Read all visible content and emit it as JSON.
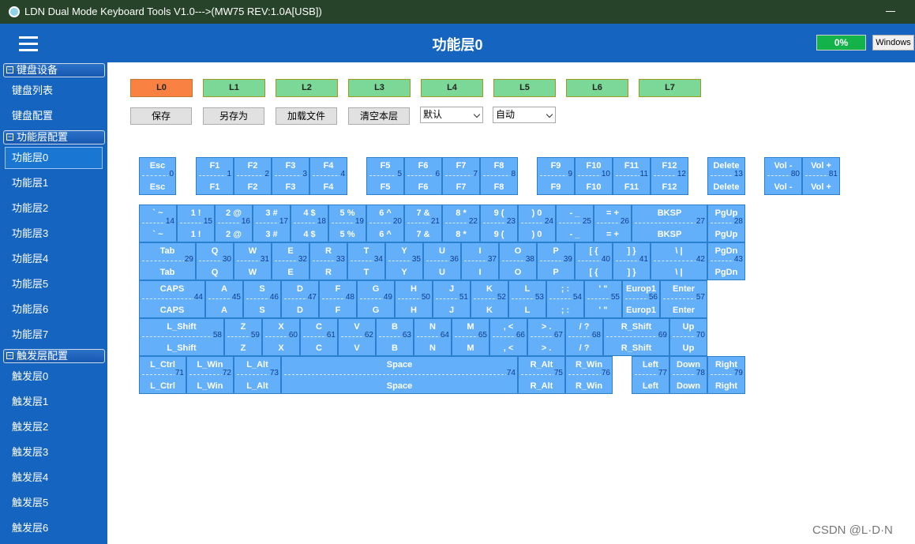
{
  "window": {
    "title": "LDN Dual Mode Keyboard Tools V1.0--->(MW75 REV:1.0A[USB])"
  },
  "header": {
    "page_title": "功能层0",
    "progress": "0%",
    "os_label": "Windows"
  },
  "sidebar": {
    "sections": [
      {
        "title": "键盘设备",
        "toggle": "−"
      },
      {
        "title": "功能层配置",
        "toggle": "−"
      },
      {
        "title": "触发层配置",
        "toggle": "−"
      }
    ],
    "device_items": [
      "键盘列表",
      "键盘配置"
    ],
    "fn_layer_items": [
      "功能层0",
      "功能层1",
      "功能层2",
      "功能层3",
      "功能层4",
      "功能层5",
      "功能层6",
      "功能层7"
    ],
    "trigger_layer_items": [
      "触发层0",
      "触发层1",
      "触发层2",
      "触发层3",
      "触发层4",
      "触发层5",
      "触发层6"
    ]
  },
  "layers": [
    "L0",
    "L1",
    "L2",
    "L3",
    "L4",
    "L5",
    "L6",
    "L7"
  ],
  "active_layer": "L0",
  "toolbar": {
    "save": "保存",
    "save_as": "另存为",
    "load_file": "加载文件",
    "clear_layer": "清空本层",
    "select_default": "默认",
    "select_auto": "自动"
  },
  "keys": [
    {
      "t": "Esc",
      "b": "Esc",
      "n": "0"
    },
    {
      "t": "F1",
      "b": "F1",
      "n": "1"
    },
    {
      "t": "F2",
      "b": "F2",
      "n": "2"
    },
    {
      "t": "F3",
      "b": "F3",
      "n": "3"
    },
    {
      "t": "F4",
      "b": "F4",
      "n": "4"
    },
    {
      "t": "F5",
      "b": "F5",
      "n": "5"
    },
    {
      "t": "F6",
      "b": "F6",
      "n": "6"
    },
    {
      "t": "F7",
      "b": "F7",
      "n": "7"
    },
    {
      "t": "F8",
      "b": "F8",
      "n": "8"
    },
    {
      "t": "F9",
      "b": "F9",
      "n": "9"
    },
    {
      "t": "F10",
      "b": "F10",
      "n": "10"
    },
    {
      "t": "F11",
      "b": "F11",
      "n": "11"
    },
    {
      "t": "F12",
      "b": "F12",
      "n": "12"
    },
    {
      "t": "Delete",
      "b": "Delete",
      "n": "13"
    },
    {
      "t": "Vol -",
      "b": "Vol -",
      "n": "80"
    },
    {
      "t": "Vol +",
      "b": "Vol +",
      "n": "81"
    },
    {
      "t": "` ~",
      "b": "` ~",
      "n": "14"
    },
    {
      "t": "1 !",
      "b": "1 !",
      "n": "15"
    },
    {
      "t": "2 @",
      "b": "2 @",
      "n": "16"
    },
    {
      "t": "3 #",
      "b": "3 #",
      "n": "17"
    },
    {
      "t": "4 $",
      "b": "4 $",
      "n": "18"
    },
    {
      "t": "5 %",
      "b": "5 %",
      "n": "19"
    },
    {
      "t": "6 ^",
      "b": "6 ^",
      "n": "20"
    },
    {
      "t": "7 &",
      "b": "7 &",
      "n": "21"
    },
    {
      "t": "8 *",
      "b": "8 *",
      "n": "22"
    },
    {
      "t": "9 (",
      "b": "9 (",
      "n": "23"
    },
    {
      "t": ") 0",
      "b": ") 0",
      "n": "24"
    },
    {
      "t": "- _",
      "b": "- _",
      "n": "25"
    },
    {
      "t": "= +",
      "b": "= +",
      "n": "26"
    },
    {
      "t": "BKSP",
      "b": "BKSP",
      "n": "27"
    },
    {
      "t": "PgUp",
      "b": "PgUp",
      "n": "28"
    },
    {
      "t": "Tab",
      "b": "Tab",
      "n": "29"
    },
    {
      "t": "Q",
      "b": "Q",
      "n": "30"
    },
    {
      "t": "W",
      "b": "W",
      "n": "31"
    },
    {
      "t": "E",
      "b": "E",
      "n": "32"
    },
    {
      "t": "R",
      "b": "R",
      "n": "33"
    },
    {
      "t": "T",
      "b": "T",
      "n": "34"
    },
    {
      "t": "Y",
      "b": "Y",
      "n": "35"
    },
    {
      "t": "U",
      "b": "U",
      "n": "36"
    },
    {
      "t": "I",
      "b": "I",
      "n": "37"
    },
    {
      "t": "O",
      "b": "O",
      "n": "38"
    },
    {
      "t": "P",
      "b": "P",
      "n": "39"
    },
    {
      "t": "[ {",
      "b": "[ {",
      "n": "40"
    },
    {
      "t": "] }",
      "b": "] }",
      "n": "41"
    },
    {
      "t": "\\ |",
      "b": "\\ |",
      "n": "42"
    },
    {
      "t": "PgDn",
      "b": "PgDn",
      "n": "43"
    },
    {
      "t": "CAPS",
      "b": "CAPS",
      "n": "44"
    },
    {
      "t": "A",
      "b": "A",
      "n": "45"
    },
    {
      "t": "S",
      "b": "S",
      "n": "46"
    },
    {
      "t": "D",
      "b": "D",
      "n": "47"
    },
    {
      "t": "F",
      "b": "F",
      "n": "48"
    },
    {
      "t": "G",
      "b": "G",
      "n": "49"
    },
    {
      "t": "H",
      "b": "H",
      "n": "50"
    },
    {
      "t": "J",
      "b": "J",
      "n": "51"
    },
    {
      "t": "K",
      "b": "K",
      "n": "52"
    },
    {
      "t": "L",
      "b": "L",
      "n": "53"
    },
    {
      "t": "; :",
      "b": "; :",
      "n": "54"
    },
    {
      "t": "' \"",
      "b": "' \"",
      "n": "55"
    },
    {
      "t": "Europ1",
      "b": "Europ1",
      "n": "56"
    },
    {
      "t": "Enter",
      "b": "Enter",
      "n": "57"
    },
    {
      "t": "L_Shift",
      "b": "L_Shift",
      "n": "58"
    },
    {
      "t": "Z",
      "b": "Z",
      "n": "59"
    },
    {
      "t": "X",
      "b": "X",
      "n": "60"
    },
    {
      "t": "C",
      "b": "C",
      "n": "61"
    },
    {
      "t": "V",
      "b": "V",
      "n": "62"
    },
    {
      "t": "B",
      "b": "B",
      "n": "63"
    },
    {
      "t": "N",
      "b": "N",
      "n": "64"
    },
    {
      "t": "M",
      "b": "M",
      "n": "65"
    },
    {
      "t": ", <",
      "b": ", <",
      "n": "66"
    },
    {
      "t": "> .",
      "b": "> .",
      "n": "67"
    },
    {
      "t": "/ ?",
      "b": "/ ?",
      "n": "68"
    },
    {
      "t": "R_Shift",
      "b": "R_Shift",
      "n": "69"
    },
    {
      "t": "Up",
      "b": "Up",
      "n": "70"
    },
    {
      "t": "L_Ctrl",
      "b": "L_Ctrl",
      "n": "71"
    },
    {
      "t": "L_Win",
      "b": "L_Win",
      "n": "72"
    },
    {
      "t": "L_Alt",
      "b": "L_Alt",
      "n": "73"
    },
    {
      "t": "Space",
      "b": "Space",
      "n": "74"
    },
    {
      "t": "R_Alt",
      "b": "R_Alt",
      "n": "75"
    },
    {
      "t": "R_Win",
      "b": "R_Win",
      "n": "76"
    },
    {
      "t": "Left",
      "b": "Left",
      "n": "77"
    },
    {
      "t": "Down",
      "b": "Down",
      "n": "78"
    },
    {
      "t": "Right",
      "b": "Right",
      "n": "79"
    }
  ],
  "watermark": "CSDN @L·D·N",
  "colors": {
    "key": "#64affa",
    "layer": "#7bd896",
    "layer_active": "#f98242",
    "sidebar": "#1565c0",
    "progress": "#14b34a"
  }
}
